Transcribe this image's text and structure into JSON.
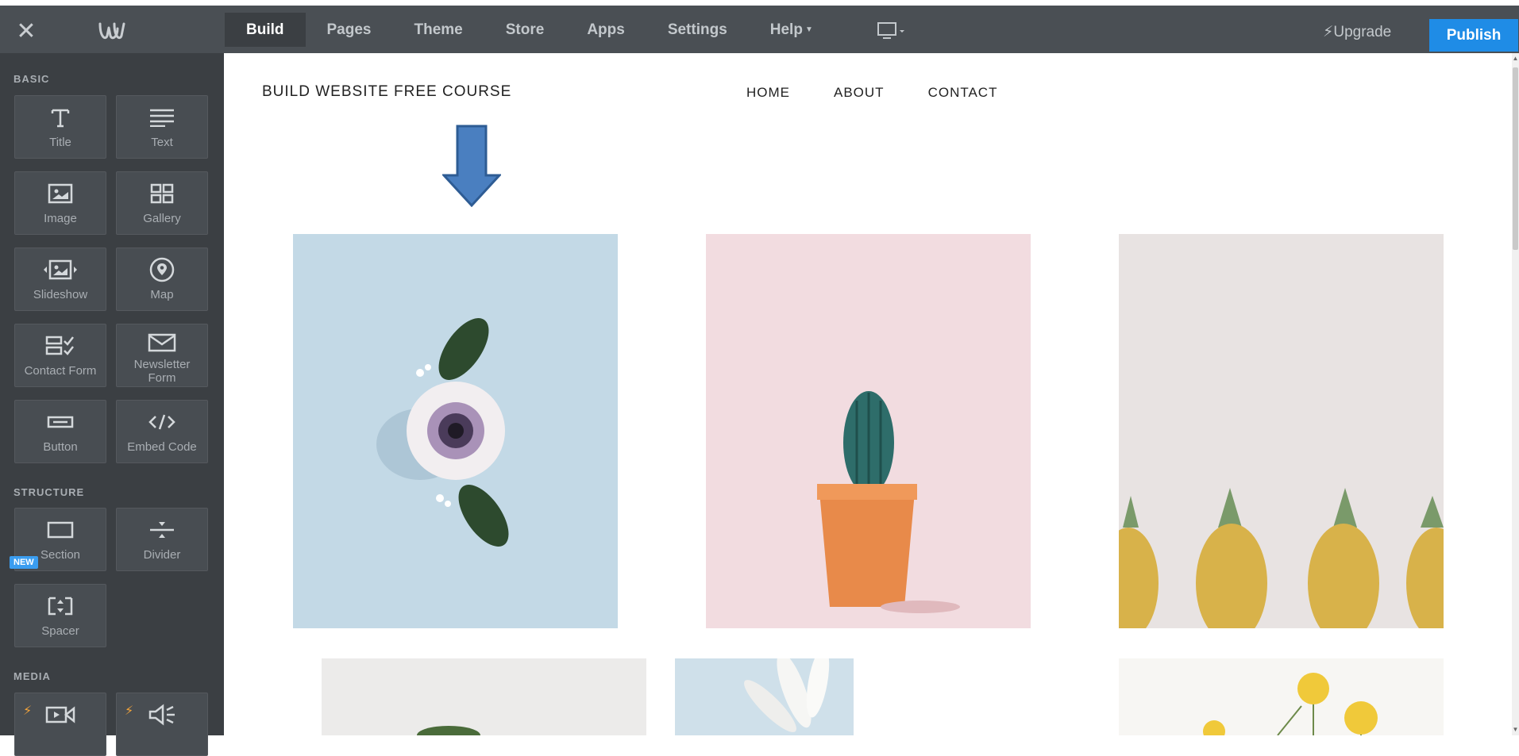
{
  "topbar": {
    "nav": [
      {
        "label": "Build",
        "active": true
      },
      {
        "label": "Pages"
      },
      {
        "label": "Theme"
      },
      {
        "label": "Store"
      },
      {
        "label": "Apps"
      },
      {
        "label": "Settings"
      },
      {
        "label": "Help"
      }
    ],
    "upgrade_label": "Upgrade",
    "publish_label": "Publish"
  },
  "sidebar": {
    "sections": {
      "basic": "BASIC",
      "structure": "STRUCTURE",
      "media": "MEDIA"
    },
    "new_badge": "NEW",
    "tiles": {
      "title": "Title",
      "text": "Text",
      "image": "Image",
      "gallery": "Gallery",
      "slideshow": "Slideshow",
      "map": "Map",
      "contact_form": "Contact Form",
      "newsletter_line1": "Newsletter",
      "newsletter_line2": "Form",
      "button": "Button",
      "embed_code": "Embed Code",
      "section": "Section",
      "divider": "Divider",
      "spacer": "Spacer"
    }
  },
  "site": {
    "title": "BUILD WEBSITE FREE COURSE",
    "nav": [
      "HOME",
      "ABOUT",
      "CONTACT"
    ]
  },
  "colors": {
    "topbar": "#4a4f54",
    "sidebar": "#3b3f43",
    "publish": "#1f8ce6",
    "arrow": "#4a7fc0"
  }
}
